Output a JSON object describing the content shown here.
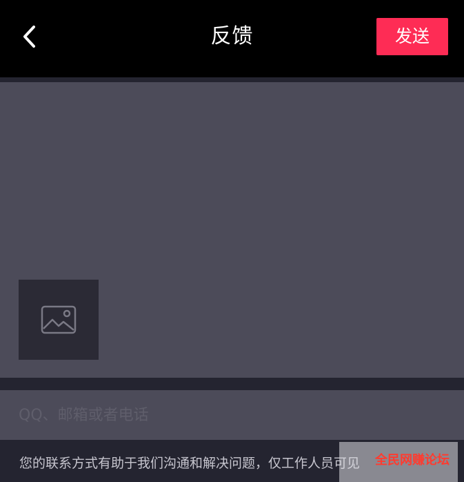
{
  "header": {
    "title": "反馈",
    "send_label": "发送",
    "back_icon": "chevron-left-icon"
  },
  "feedback": {
    "value": "",
    "image_icon": "image-icon"
  },
  "contact": {
    "placeholder": "QQ、邮箱或者电话",
    "value": ""
  },
  "hint": {
    "text": "您的联系方式有助于我们沟通和解决问题，仅工作人员可见"
  },
  "watermark": {
    "text": "全民网赚论坛"
  },
  "colors": {
    "accent": "#fe2c55",
    "panel": "#4c4b59",
    "background": "#242430",
    "topbar": "#000000"
  }
}
